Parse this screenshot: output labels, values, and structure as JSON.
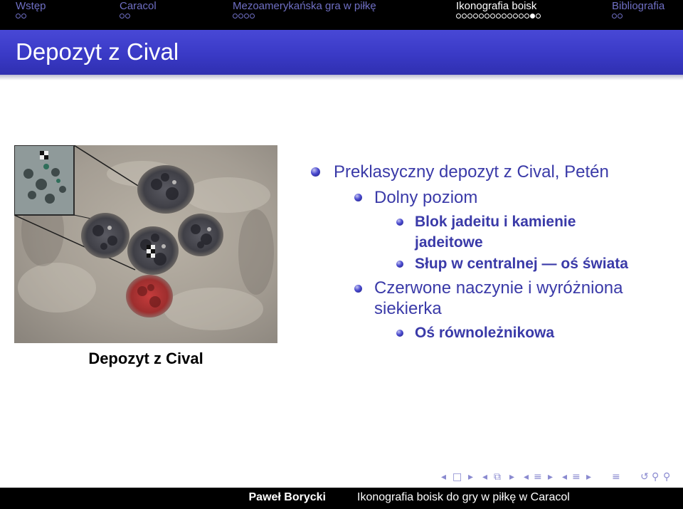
{
  "nav": {
    "sections": [
      {
        "title": "Wstęp",
        "dots": 2,
        "filled_index": -1,
        "active": false
      },
      {
        "title": "Caracol",
        "dots": 2,
        "filled_index": -1,
        "active": false
      },
      {
        "title": "Mezoamerykańska gra w piłkę",
        "dots": 4,
        "filled_index": -1,
        "active": false
      },
      {
        "title": "Ikonografia boisk",
        "dots": 15,
        "filled_index": 13,
        "active": true
      },
      {
        "title": "Bibliografia",
        "dots": 2,
        "filled_index": -1,
        "active": false
      }
    ]
  },
  "frame": {
    "title": "Depozyt z Cival"
  },
  "photo": {
    "caption": "Depozyt z Cival"
  },
  "bullets": {
    "b1": "Preklasyczny depozyt z Cival, Petén",
    "b1_1": "Dolny poziom",
    "b1_1_1_line1": "Blok jadeitu i kamienie",
    "b1_1_1_line2": "jadeitowe",
    "b1_1_2": "Słup w centralnej — oś świata",
    "b1_2_line1": "Czerwone naczynie i wyróżniona",
    "b1_2_line2": "siekierka",
    "b1_2_1": "Oś równoleżnikowa"
  },
  "footer": {
    "author": "Paweł Borycki",
    "talk_title": "Ikonografia boisk do gry w piłkę w Caracol"
  },
  "colors": {
    "nav_inactive": "#6f6fc4",
    "title_bar": "#3a3ac6",
    "bullet_text": "#3a3aa8"
  }
}
